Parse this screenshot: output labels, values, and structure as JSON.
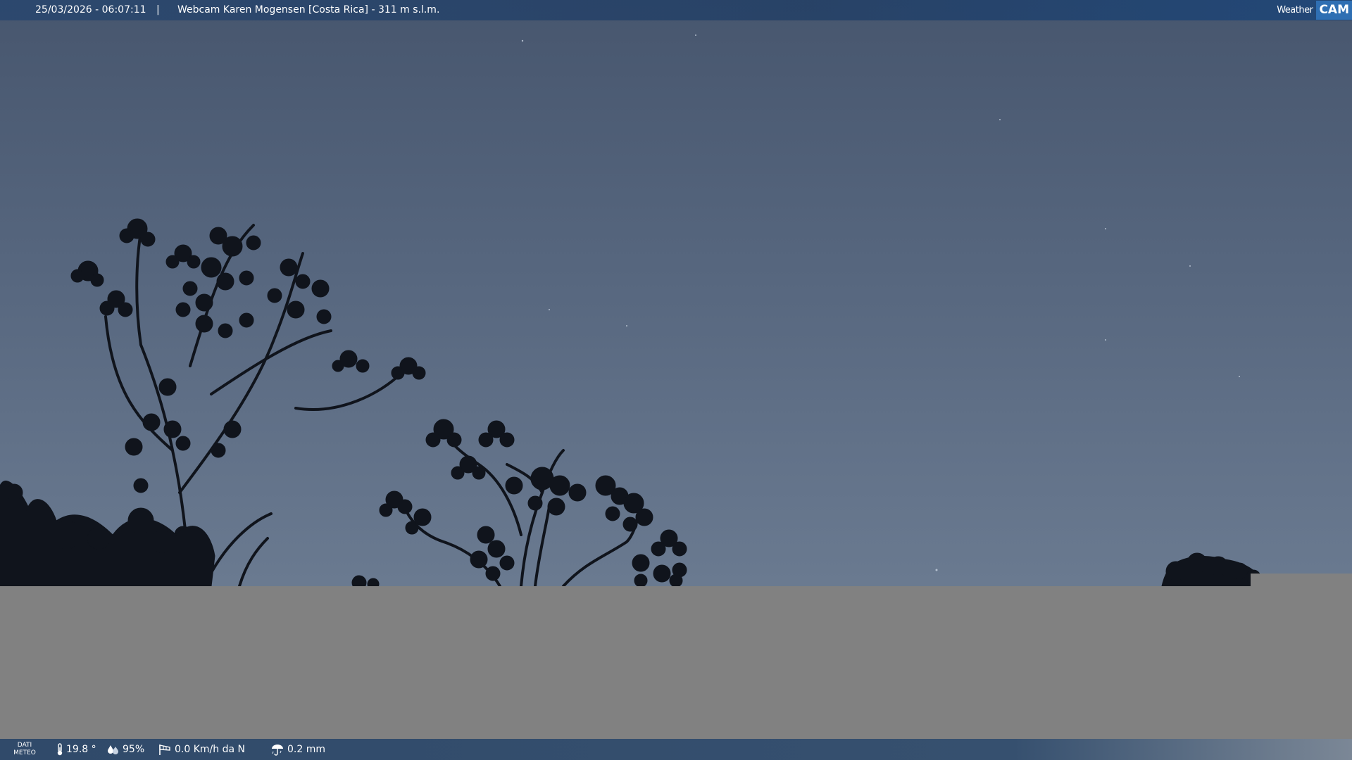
{
  "header": {
    "datetime": "25/03/2026 - 06:07:11",
    "separator": "|",
    "title": "Webcam Karen Mogensen [Costa Rica]  - 311 m s.l.m."
  },
  "logo": {
    "weather_text": "Weather",
    "cam_text": "CAM"
  },
  "weather_bar": {
    "label_line1": "DATI",
    "label_line2": "METEO",
    "temperature": "19.8 °",
    "humidity": "95%",
    "wind": "0.0 Km/h da N",
    "rain": "0.2 mm"
  },
  "icons": {
    "temperature": "thermometer-icon",
    "humidity": "humidity-drops-icon",
    "wind": "wind-sock-icon",
    "rain": "rain-gauge-icon"
  },
  "colors": {
    "top_bar": "#2a4a72",
    "bottom_bar": "#304a6a",
    "logo_accent": "#2f6fb3",
    "panel_gray": "#818181"
  }
}
